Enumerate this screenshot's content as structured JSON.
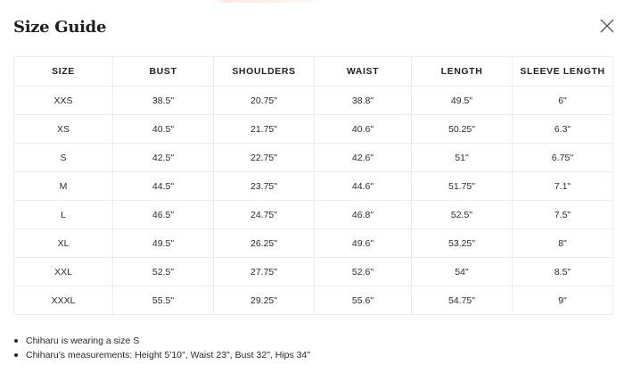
{
  "modal": {
    "title": "Size Guide",
    "close_icon": "close-icon"
  },
  "table": {
    "headers": [
      "SIZE",
      "BUST",
      "SHOULDERS",
      "WAIST",
      "LENGTH",
      "SLEEVE LENGTH"
    ],
    "rows": [
      [
        "XXS",
        "38.5\"",
        "20.75\"",
        "38.8\"",
        "49.5\"",
        "6\""
      ],
      [
        "XS",
        "40.5\"",
        "21.75\"",
        "40.6\"",
        "50.25\"",
        "6.3\""
      ],
      [
        "S",
        "42.5\"",
        "22.75\"",
        "42.6\"",
        "51\"",
        "6.75\""
      ],
      [
        "M",
        "44.5\"",
        "23.75\"",
        "44.6\"",
        "51.75\"",
        "7.1\""
      ],
      [
        "L",
        "46.5\"",
        "24.75\"",
        "46.8\"",
        "52.5\"",
        "7.5\""
      ],
      [
        "XL",
        "49.5\"",
        "26.25\"",
        "49.6\"",
        "53.25\"",
        "8\""
      ],
      [
        "XXL",
        "52.5\"",
        "27.75\"",
        "52.6\"",
        "54\"",
        "8.5\""
      ],
      [
        "XXXL",
        "55.5\"",
        "29.25\"",
        "55.6\"",
        "54.75\"",
        "9\""
      ]
    ]
  },
  "notes": [
    "Chiharu is wearing a size S",
    "Chiharu's measurements: Height 5'10\", Waist 23\", Bust 32\", Hips 34\""
  ]
}
